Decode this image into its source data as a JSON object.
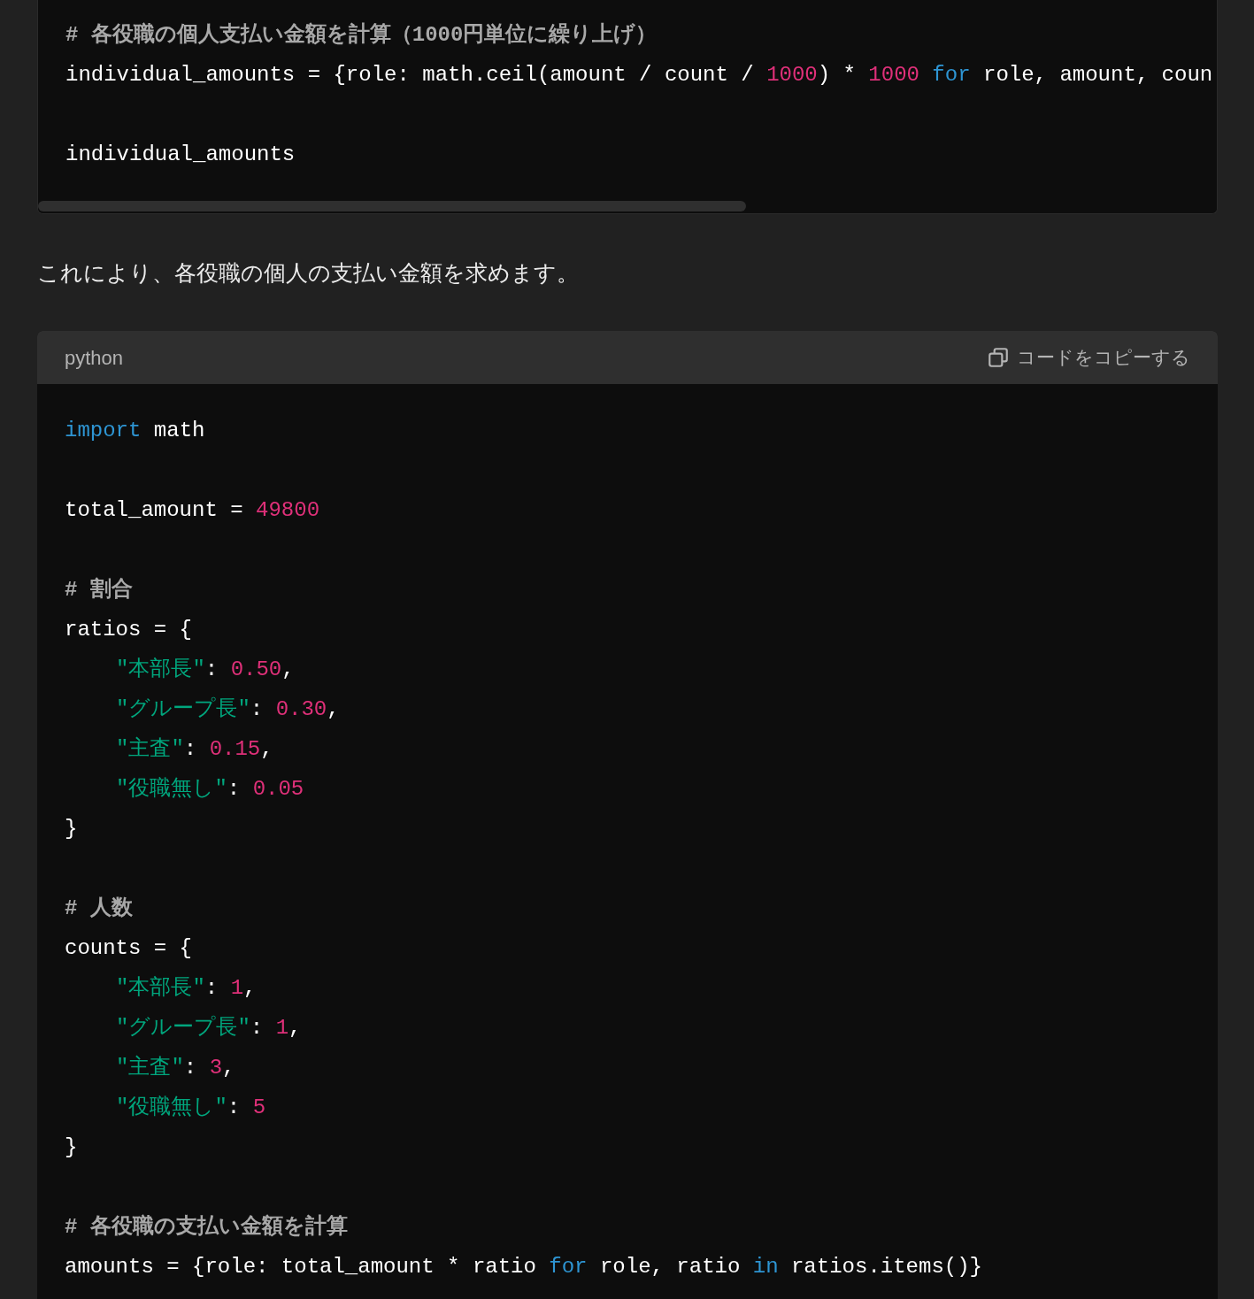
{
  "code_block_top": {
    "lines": [
      {
        "kind": "code",
        "indented": false,
        "tokens": [
          {
            "kind": "comment",
            "text": "# 各役職の個人支払い金額を計算（1000円単位に繰り上げ）"
          }
        ]
      },
      {
        "kind": "code",
        "indented": false,
        "tokens": [
          {
            "kind": "plain",
            "text": "individual_amounts = {role: math.ceil(amount / count / "
          },
          {
            "kind": "number",
            "text": "1000"
          },
          {
            "kind": "plain",
            "text": ") * "
          },
          {
            "kind": "number",
            "text": "1000"
          },
          {
            "kind": "keyword",
            "text": " for"
          },
          {
            "kind": "plain",
            "text": " role, amount, coun"
          }
        ]
      },
      {
        "kind": "blank"
      },
      {
        "kind": "code",
        "indented": false,
        "tokens": [
          {
            "kind": "plain",
            "text": "individual_amounts"
          }
        ]
      }
    ]
  },
  "paragraph": "これにより、各役職の個人の支払い金額を求めます。",
  "code_block": {
    "language": "python",
    "copy_label": "コードをコピーする",
    "lines": [
      {
        "kind": "code",
        "indented": false,
        "tokens": [
          {
            "kind": "keyword",
            "text": "import"
          },
          {
            "kind": "plain",
            "text": " math"
          }
        ]
      },
      {
        "kind": "blank"
      },
      {
        "kind": "code",
        "indented": false,
        "tokens": [
          {
            "kind": "plain",
            "text": "total_amount = "
          },
          {
            "kind": "number",
            "text": "49800"
          }
        ]
      },
      {
        "kind": "blank"
      },
      {
        "kind": "code",
        "indented": false,
        "tokens": [
          {
            "kind": "comment",
            "text": "# 割合"
          }
        ]
      },
      {
        "kind": "code",
        "indented": false,
        "tokens": [
          {
            "kind": "plain",
            "text": "ratios = {"
          }
        ]
      },
      {
        "kind": "code",
        "indented": true,
        "tokens": [
          {
            "kind": "string",
            "text": "\"本部長\""
          },
          {
            "kind": "plain",
            "text": ": "
          },
          {
            "kind": "number",
            "text": "0.50"
          },
          {
            "kind": "plain",
            "text": ","
          }
        ]
      },
      {
        "kind": "code",
        "indented": true,
        "tokens": [
          {
            "kind": "string",
            "text": "\"グループ長\""
          },
          {
            "kind": "plain",
            "text": ": "
          },
          {
            "kind": "number",
            "text": "0.30"
          },
          {
            "kind": "plain",
            "text": ","
          }
        ]
      },
      {
        "kind": "code",
        "indented": true,
        "tokens": [
          {
            "kind": "string",
            "text": "\"主査\""
          },
          {
            "kind": "plain",
            "text": ": "
          },
          {
            "kind": "number",
            "text": "0.15"
          },
          {
            "kind": "plain",
            "text": ","
          }
        ]
      },
      {
        "kind": "code",
        "indented": true,
        "tokens": [
          {
            "kind": "string",
            "text": "\"役職無し\""
          },
          {
            "kind": "plain",
            "text": ": "
          },
          {
            "kind": "number",
            "text": "0.05"
          }
        ]
      },
      {
        "kind": "code",
        "indented": false,
        "tokens": [
          {
            "kind": "plain",
            "text": "}"
          }
        ]
      },
      {
        "kind": "blank"
      },
      {
        "kind": "code",
        "indented": false,
        "tokens": [
          {
            "kind": "comment",
            "text": "# 人数"
          }
        ]
      },
      {
        "kind": "code",
        "indented": false,
        "tokens": [
          {
            "kind": "plain",
            "text": "counts = {"
          }
        ]
      },
      {
        "kind": "code",
        "indented": true,
        "tokens": [
          {
            "kind": "string",
            "text": "\"本部長\""
          },
          {
            "kind": "plain",
            "text": ": "
          },
          {
            "kind": "number",
            "text": "1"
          },
          {
            "kind": "plain",
            "text": ","
          }
        ]
      },
      {
        "kind": "code",
        "indented": true,
        "tokens": [
          {
            "kind": "string",
            "text": "\"グループ長\""
          },
          {
            "kind": "plain",
            "text": ": "
          },
          {
            "kind": "number",
            "text": "1"
          },
          {
            "kind": "plain",
            "text": ","
          }
        ]
      },
      {
        "kind": "code",
        "indented": true,
        "tokens": [
          {
            "kind": "string",
            "text": "\"主査\""
          },
          {
            "kind": "plain",
            "text": ": "
          },
          {
            "kind": "number",
            "text": "3"
          },
          {
            "kind": "plain",
            "text": ","
          }
        ]
      },
      {
        "kind": "code",
        "indented": true,
        "tokens": [
          {
            "kind": "string",
            "text": "\"役職無し\""
          },
          {
            "kind": "plain",
            "text": ": "
          },
          {
            "kind": "number",
            "text": "5"
          }
        ]
      },
      {
        "kind": "code",
        "indented": false,
        "tokens": [
          {
            "kind": "plain",
            "text": "}"
          }
        ]
      },
      {
        "kind": "blank"
      },
      {
        "kind": "code",
        "indented": false,
        "tokens": [
          {
            "kind": "comment",
            "text": "# 各役職の支払い金額を計算"
          }
        ]
      },
      {
        "kind": "code",
        "indented": false,
        "tokens": [
          {
            "kind": "plain",
            "text": "amounts = {role: total_amount * ratio "
          },
          {
            "kind": "keyword",
            "text": "for"
          },
          {
            "kind": "plain",
            "text": " role, ratio "
          },
          {
            "kind": "keyword",
            "text": "in"
          },
          {
            "kind": "plain",
            "text": " ratios.items()}"
          }
        ]
      }
    ]
  }
}
